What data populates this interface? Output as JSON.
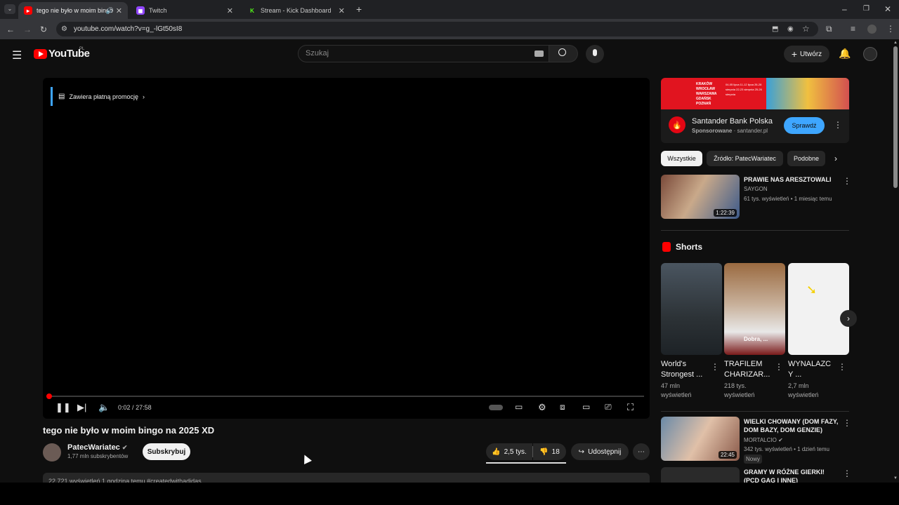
{
  "browser": {
    "tabs": [
      {
        "title": "tego nie było w moim bingo",
        "active": true
      },
      {
        "title": "Twitch",
        "active": false
      },
      {
        "title": "Stream - Kick Dashboard",
        "active": false
      }
    ],
    "url": "youtube.com/watch?v=g_-lGt50sI8"
  },
  "header": {
    "logo_text": "YouTube",
    "region": "PL",
    "search_placeholder": "Szukaj",
    "create_label": "Utwórz"
  },
  "player": {
    "promo_label": "Zawiera płatną promocję",
    "time_current": "0:02",
    "time_separator": "/",
    "time_total": "27:58",
    "progress_fraction": 0.0012
  },
  "video": {
    "title": "tego nie było w moim bingo na 2025 XD",
    "channel": "PatecWariatec",
    "subscribers": "1,77 mln subskrybentów",
    "subscribe_label": "Subskrybuj",
    "likes": "2,5 tys.",
    "dislikes": "18",
    "share_label": "Udostępnij",
    "description_line": "22 721 wyświetleń  1 godzina temu  #createdwithadidas"
  },
  "ad": {
    "banner_cities": "KRAKÓW  WROCŁAW  WARSZAWA  GDAŃSK  POZNAŃ",
    "banner_dates": "04-05 lipca  11-12 lipca  26-28 sierpnia  22-23 sierpnia  25-26 sierpnia",
    "advertiser": "Santander Bank Polska",
    "sponsored": "Sponsorowane",
    "separator": "·",
    "domain": "santander.pl",
    "cta": "Sprawdź"
  },
  "chips": [
    "Wszystkie",
    "Źródło: PatecWariatec",
    "Podobne"
  ],
  "related": [
    {
      "title": "PRAWIE NAS ARESZTOWALI",
      "channel": "SAYGON",
      "meta": "61 tys. wyświetleń • 1 miesiąc temu",
      "duration": "1:22:39"
    },
    {
      "title": "WIELKI CHOWANY (DOM FAZY, DOM BAZY, DOM GENZIE)",
      "channel": "MORTALCIO",
      "meta": "342 tys. wyświetleń • 1 dzień temu",
      "badge": "Nowy",
      "duration": "22:45"
    },
    {
      "title": "GRAMY W RÓŻNE GIERKI! (PCD GAG I INNE) ZAPRASZAM"
    }
  ],
  "shorts": {
    "heading": "Shorts",
    "items": [
      {
        "title_line1": "World's",
        "title_line2": "Strongest ...",
        "views_line1": "47 mln",
        "views_line2": "wyświetleń"
      },
      {
        "title_line1": "TRAFILEM",
        "title_line2": "CHARIZAR...",
        "views_line1": "218 tys.",
        "views_line2": "wyświetleń",
        "overlay": "Dobra, ..."
      },
      {
        "title_line1": "WYNALAZC",
        "title_line2": "Y ...",
        "views_line1": "2,7 mln",
        "views_line2": "wyświetleń"
      }
    ]
  },
  "colors": {
    "brand": "#ff0000",
    "accent": "#3ea6ff",
    "bg": "#0f0f0f"
  }
}
